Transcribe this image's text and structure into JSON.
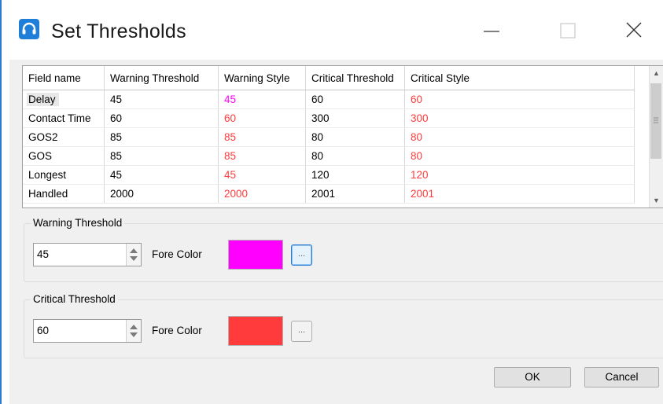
{
  "window": {
    "title": "Set Thresholds",
    "icon": "headset-icon",
    "accent": "#2a7ad2"
  },
  "grid": {
    "columns": [
      "Field name",
      "Warning Threshold",
      "Warning Style",
      "Critical Threshold",
      "Critical Style"
    ],
    "rows": [
      {
        "name": "Delay",
        "warning": "45",
        "warning_style": "45",
        "critical": "60",
        "critical_style": "60",
        "warning_color": "#ff00ff"
      },
      {
        "name": "Contact Time",
        "warning": "60",
        "warning_style": "60",
        "critical": "300",
        "critical_style": "300",
        "warning_color": "#ff3b3b"
      },
      {
        "name": "GOS2",
        "warning": "85",
        "warning_style": "85",
        "critical": "80",
        "critical_style": "80",
        "warning_color": "#ff3b3b"
      },
      {
        "name": "GOS",
        "warning": "85",
        "warning_style": "85",
        "critical": "80",
        "critical_style": "80",
        "warning_color": "#ff3b3b"
      },
      {
        "name": "Longest",
        "warning": "45",
        "warning_style": "45",
        "critical": "120",
        "critical_style": "120",
        "warning_color": "#ff3b3b"
      },
      {
        "name": "Handled",
        "warning": "2000",
        "warning_style": "2000",
        "critical": "2001",
        "critical_style": "2001",
        "warning_color": "#ff3b3b"
      }
    ],
    "selected_row": "Delay"
  },
  "warning_group": {
    "title": "Warning Threshold",
    "value": "45",
    "fore_color_label": "Fore Color",
    "color": "#ff00ff",
    "picker_label": "..."
  },
  "critical_group": {
    "title": "Critical Threshold",
    "value": "60",
    "fore_color_label": "Fore Color",
    "color": "#ff3b3b",
    "picker_label": "..."
  },
  "buttons": {
    "ok": "OK",
    "cancel": "Cancel"
  }
}
